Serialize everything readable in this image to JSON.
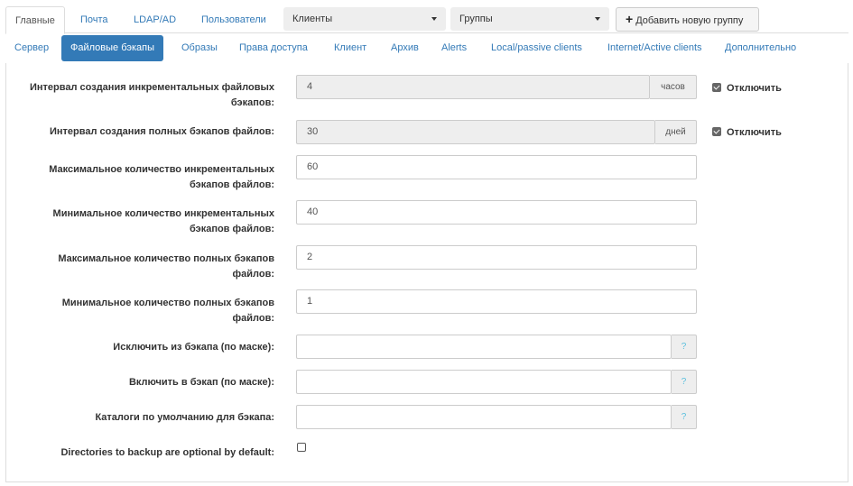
{
  "top_tabs": [
    "Главные",
    "Почта",
    "LDAP/AD",
    "Пользователи"
  ],
  "clients_dropdown": "Клиенты",
  "groups_dropdown": "Группы",
  "add_group_button": "Добавить новую группу",
  "sub_tabs": [
    "Сервер",
    "Файловые бэкапы",
    "Образы",
    "Права доступа",
    "Клиент",
    "Архив",
    "Alerts",
    "Local/passive clients",
    "Internet/Active clients",
    "Дополнительно"
  ],
  "form": {
    "incr_interval": {
      "label_line1": "Интервал создания инкрементальных файловых",
      "label_line2": "бэкапов:",
      "value": "4",
      "unit": "часов",
      "checkbox_label": "Отключить",
      "checked": true
    },
    "full_interval": {
      "label": "Интервал создания полных бэкапов файлов:",
      "value": "30",
      "unit": "дней",
      "checkbox_label": "Отключить",
      "checked": true
    },
    "max_incr": {
      "label_line1": "Максимальное количество инкрементальных",
      "label_line2": "бэкапов файлов:",
      "value": "60"
    },
    "min_incr": {
      "label_line1": "Минимальное количество инкрементальных",
      "label_line2": "бэкапов файлов:",
      "value": "40"
    },
    "max_full": {
      "label_line1": "Максимальное количество полных бэкапов",
      "label_line2": "файлов:",
      "value": "2"
    },
    "min_full": {
      "label_line1": "Минимальное количество полных бэкапов",
      "label_line2": "файлов:",
      "value": "1"
    },
    "exclude_mask": {
      "label": "Исключить из бэкапа (по маске):",
      "value": "",
      "help": "?"
    },
    "include_mask": {
      "label": "Включить в бэкап (по маске):",
      "value": "",
      "help": "?"
    },
    "default_dirs": {
      "label": "Каталоги по умолчанию для бэкапа:",
      "value": "",
      "help": "?"
    },
    "dirs_optional": {
      "label": "Directories to backup are optional by default:",
      "checked": false
    }
  },
  "colors": {
    "accent": "#337ab7",
    "help_icon": "#5bc0de",
    "disabled_bg": "#eeeeee"
  }
}
